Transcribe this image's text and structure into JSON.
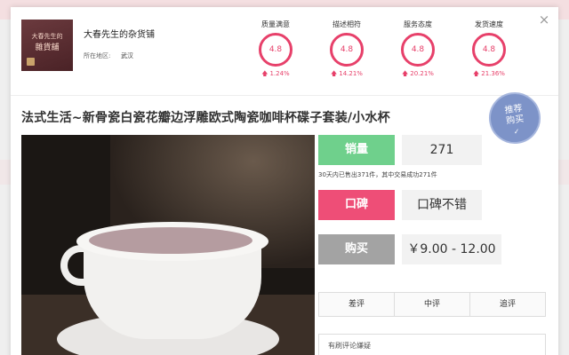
{
  "shop": {
    "name": "大春先生的杂货铺",
    "region_label": "所在地区:",
    "region": "武汉",
    "logo_line1": "大春先生的",
    "logo_line2": "雜貨舖"
  },
  "ratings": [
    {
      "label": "质量满意",
      "score": "4.8",
      "trend": "1.24%"
    },
    {
      "label": "描述相符",
      "score": "4.8",
      "trend": "14.21%"
    },
    {
      "label": "服务态度",
      "score": "4.8",
      "trend": "20.21%"
    },
    {
      "label": "发货速度",
      "score": "4.8",
      "trend": "21.36%"
    }
  ],
  "close_label": "×",
  "product": {
    "title": "法式生活~新骨瓷白瓷花瓣边浮雕欧式陶瓷咖啡杯碟子套装/小水杯"
  },
  "badge": {
    "line1": "推荐",
    "line2": "购买",
    "mark": "✓"
  },
  "info": {
    "sales_label": "销量",
    "sales_value": "271",
    "sales_note": "30天内已售出371件，其中交易成功271件",
    "reputation_label": "口碑",
    "reputation_value": "口碑不错",
    "buy_label": "购买",
    "price": "￥9.00 - 12.00"
  },
  "review_tabs": [
    "差评",
    "中评",
    "追评"
  ],
  "notice": "有刷评论嫌疑",
  "colors": {
    "sales": "#6fd08c",
    "reputation": "#ee4e77",
    "buy": "#a3a3a3",
    "accent": "#e7406a"
  }
}
